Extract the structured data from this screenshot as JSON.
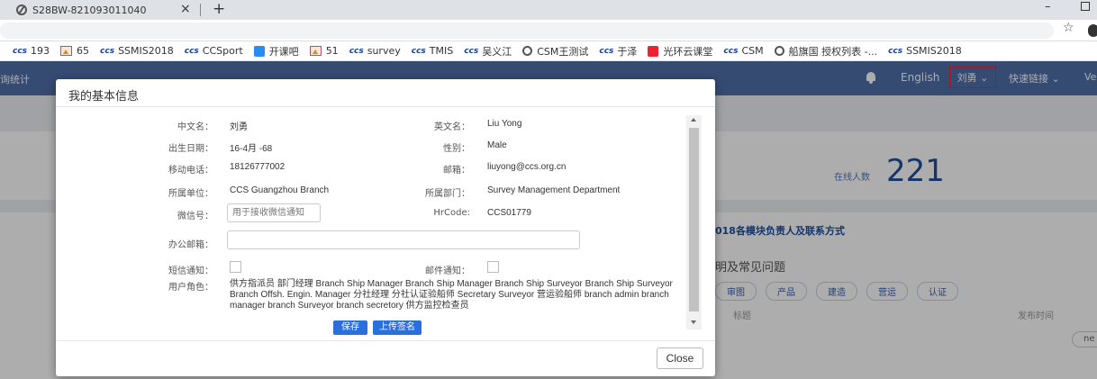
{
  "browser": {
    "tab_title": "S28BW-821093011040",
    "tab_close": "×",
    "new_tab": "+",
    "minimize": "–",
    "star": "☆"
  },
  "bookmarks": [
    {
      "logo": "ccs",
      "label": "193"
    },
    {
      "icon": "image",
      "label": "65"
    },
    {
      "logo": "ccs",
      "label": "SSMIS2018"
    },
    {
      "logo": "ccs",
      "label": "CCSport"
    },
    {
      "icon": "blue",
      "label": "开课吧"
    },
    {
      "icon": "image",
      "label": "51"
    },
    {
      "logo": "ccs",
      "label": "survey"
    },
    {
      "logo": "ccs",
      "label": "TMIS"
    },
    {
      "logo": "ccs",
      "label": "吴义江"
    },
    {
      "icon": "globe",
      "label": "CSM王测试"
    },
    {
      "logo": "ccs",
      "label": "于泽"
    },
    {
      "icon": "red",
      "label": "光环云课堂"
    },
    {
      "logo": "ccs",
      "label": "CSM"
    },
    {
      "icon": "globe",
      "label": "船旗国 授权列表 -..."
    },
    {
      "logo": "ccs",
      "label": "SSMIS2018"
    }
  ],
  "app": {
    "nav_left": "询统计",
    "language": "English",
    "user": "刘勇 ⌄",
    "quicklinks": "快速链接 ⌄",
    "nav_right": "Ve",
    "online_label": "在线人数",
    "online_count": "221",
    "panel_title": "018各模块负责人及联系方式",
    "panel_sub": "明及常见问题",
    "chips": [
      "审图",
      "产品",
      "建造",
      "营运",
      "认证"
    ],
    "col_title": "标题",
    "col_date": "发布时间",
    "ne_button": "ne"
  },
  "modal": {
    "title": "我的基本信息",
    "fields": {
      "cn_name_label": "中文名：",
      "cn_name": "刘勇",
      "en_name_label": "英文名：",
      "en_name": "Liu Yong",
      "dob_label": "出生日期：",
      "dob": "16-4月 -68",
      "gender_label": "性别：",
      "gender": "Male",
      "mobile_label": "移动电话：",
      "mobile": "18126777002",
      "email_label": "邮箱：",
      "email": "liuyong@ccs.org.cn",
      "unit_label": "所属单位：",
      "unit": "CCS Guangzhou Branch",
      "dept_label": "所属部门：",
      "dept": "Survey Management Department",
      "wechat_label": "微信号：",
      "wechat_placeholder": "用于接收微信通知",
      "hrcode_label": "HrCode:",
      "hrcode": "CCS01779",
      "office_email_label": "办公邮箱：",
      "office_email": "",
      "sms_label": "短信通知：",
      "mail_notify_label": "邮件通知：",
      "roles_label": "用户角色：",
      "roles": "供方指派员 部门经理 Branch Ship Manager Branch Ship Manager Branch Ship Surveyor Branch Ship Surveyor Branch Offsh. Engin. Manager 分社经理 分社认证验船师 Secretary Surveyor 营运验船师 branch admin branch manager branch Surveyor branch secretory 供方监控检查员"
    },
    "save_label": "保存",
    "upload_label": "上传签名",
    "close_label": "Close"
  }
}
